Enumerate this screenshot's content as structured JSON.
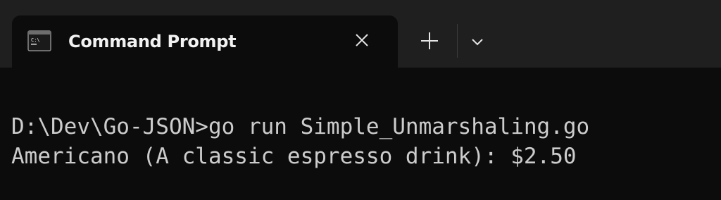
{
  "tab": {
    "title": "Command Prompt",
    "icon": "command-prompt-icon"
  },
  "toolbar": {
    "close_icon": "close-icon",
    "new_tab_icon": "plus-icon",
    "dropdown_icon": "chevron-down-icon"
  },
  "console": {
    "lines": [
      "D:\\Dev\\Go-JSON>go run Simple_Unmarshaling.go",
      "Americano (A classic espresso drink): $2.50"
    ]
  },
  "colors": {
    "background": "#0c0c0c",
    "titlebar": "#1f1f1f",
    "text": "#cccccc",
    "tab_text": "#f2f2f2"
  }
}
